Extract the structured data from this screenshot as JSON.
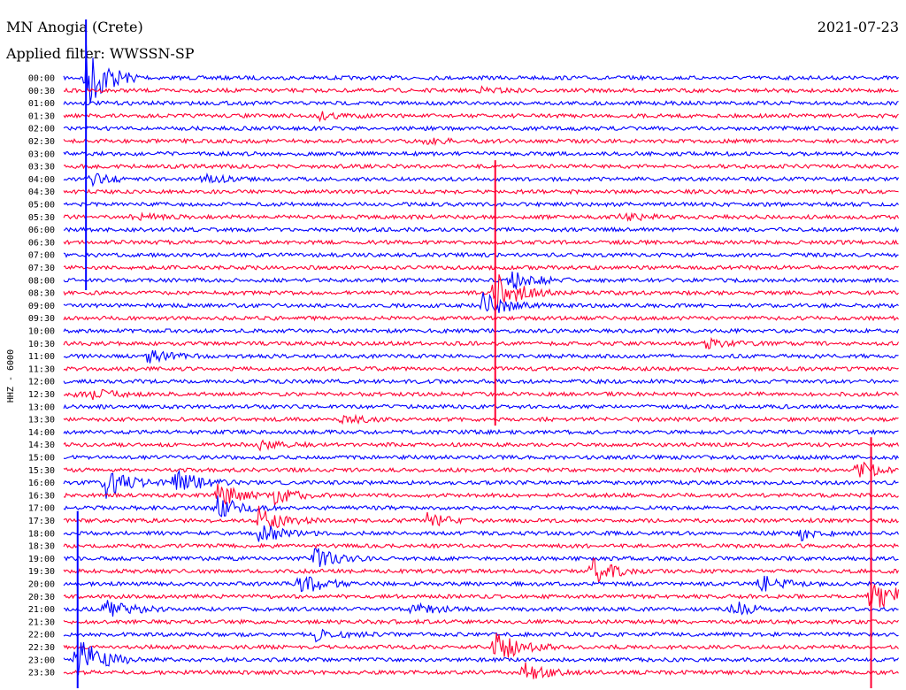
{
  "header": {
    "station": "MN Anogia (Crete)",
    "date": "2021-07-23",
    "filter": "Applied filter: WWSSN-SP",
    "channel": "HHZ - 6000"
  },
  "colors": {
    "even_trace": "#0000ff",
    "odd_trace": "#ff0033",
    "background": "#ffffff",
    "text": "#000000"
  },
  "chart_data": {
    "type": "line",
    "title": "MN Anogia (Crete)",
    "ylabel": "HHZ - 6000",
    "grid": false,
    "row_labels": [
      "00:00",
      "00:30",
      "01:00",
      "01:30",
      "02:00",
      "02:30",
      "03:00",
      "03:30",
      "04:00",
      "04:30",
      "05:00",
      "05:30",
      "06:00",
      "06:30",
      "07:00",
      "07:30",
      "08:00",
      "08:30",
      "09:00",
      "09:30",
      "10:00",
      "10:30",
      "11:00",
      "11:30",
      "12:00",
      "12:30",
      "13:00",
      "13:30",
      "14:00",
      "14:30",
      "15:00",
      "15:30",
      "16:00",
      "16:30",
      "17:00",
      "17:30",
      "18:00",
      "18:30",
      "19:00",
      "19:30",
      "20:00",
      "20:30",
      "21:00",
      "21:30",
      "22:00",
      "22:30",
      "23:00",
      "23:30"
    ],
    "events": [
      {
        "row": 0,
        "minute": 0.8,
        "amp": 40
      },
      {
        "row": 1,
        "minute": 15.0,
        "amp": 3
      },
      {
        "row": 3,
        "minute": 9.2,
        "amp": 4
      },
      {
        "row": 5,
        "minute": 13.0,
        "amp": 3
      },
      {
        "row": 8,
        "minute": 1.0,
        "amp": 6
      },
      {
        "row": 8,
        "minute": 5.0,
        "amp": 5
      },
      {
        "row": 11,
        "minute": 2.5,
        "amp": 4
      },
      {
        "row": 11,
        "minute": 20.0,
        "amp": 5
      },
      {
        "row": 16,
        "minute": 16.0,
        "amp": 14
      },
      {
        "row": 17,
        "minute": 15.5,
        "amp": 25
      },
      {
        "row": 18,
        "minute": 15.0,
        "amp": 18
      },
      {
        "row": 21,
        "minute": 23.0,
        "amp": 6
      },
      {
        "row": 22,
        "minute": 3.0,
        "amp": 8
      },
      {
        "row": 25,
        "minute": 0.5,
        "amp": 12
      },
      {
        "row": 27,
        "minute": 10.0,
        "amp": 5
      },
      {
        "row": 29,
        "minute": 7.0,
        "amp": 5
      },
      {
        "row": 31,
        "minute": 28.5,
        "amp": 10
      },
      {
        "row": 32,
        "minute": 1.5,
        "amp": 18
      },
      {
        "row": 32,
        "minute": 4.0,
        "amp": 16
      },
      {
        "row": 33,
        "minute": 5.5,
        "amp": 15
      },
      {
        "row": 33,
        "minute": 7.5,
        "amp": 12
      },
      {
        "row": 34,
        "minute": 5.5,
        "amp": 14
      },
      {
        "row": 35,
        "minute": 7.0,
        "amp": 15
      },
      {
        "row": 35,
        "minute": 13.0,
        "amp": 8
      },
      {
        "row": 36,
        "minute": 7.0,
        "amp": 12
      },
      {
        "row": 36,
        "minute": 26.5,
        "amp": 8
      },
      {
        "row": 38,
        "minute": 9.0,
        "amp": 12
      },
      {
        "row": 39,
        "minute": 19.0,
        "amp": 14
      },
      {
        "row": 40,
        "minute": 8.5,
        "amp": 14
      },
      {
        "row": 40,
        "minute": 25.0,
        "amp": 10
      },
      {
        "row": 41,
        "minute": 29.0,
        "amp": 30
      },
      {
        "row": 42,
        "minute": 1.5,
        "amp": 14
      },
      {
        "row": 42,
        "minute": 12.5,
        "amp": 7
      },
      {
        "row": 42,
        "minute": 24.0,
        "amp": 9
      },
      {
        "row": 44,
        "minute": 9.0,
        "amp": 8
      },
      {
        "row": 45,
        "minute": 15.5,
        "amp": 20
      },
      {
        "row": 46,
        "minute": 0.5,
        "amp": 28
      },
      {
        "row": 47,
        "minute": 16.5,
        "amp": 12
      }
    ]
  }
}
